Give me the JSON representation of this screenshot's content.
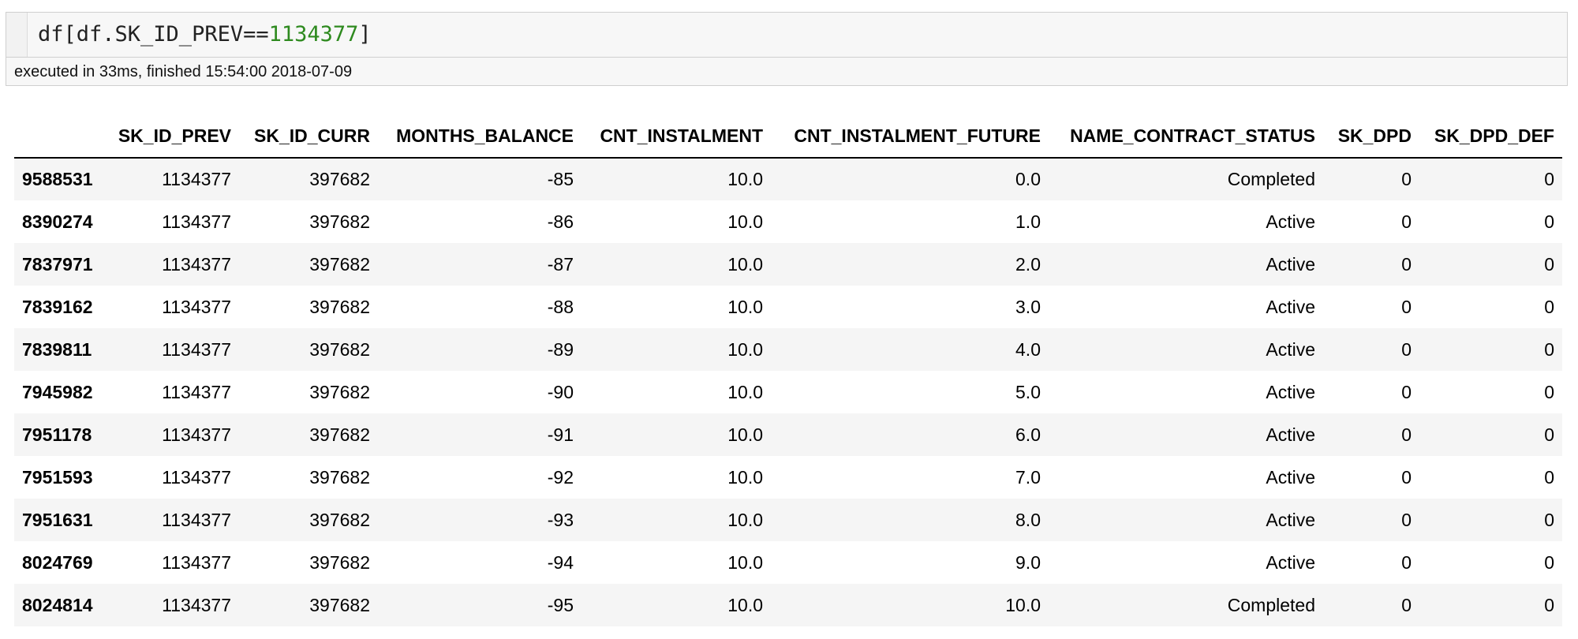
{
  "cell": {
    "code_prefix": "df[df.SK_ID_PREV==",
    "code_number": "1134377",
    "code_suffix": "]",
    "status": "executed in 33ms, finished 15:54:00 2018-07-09"
  },
  "table": {
    "columns": [
      "SK_ID_PREV",
      "SK_ID_CURR",
      "MONTHS_BALANCE",
      "CNT_INSTALMENT",
      "CNT_INSTALMENT_FUTURE",
      "NAME_CONTRACT_STATUS",
      "SK_DPD",
      "SK_DPD_DEF"
    ],
    "rows": [
      {
        "index": "9588531",
        "values": [
          "1134377",
          "397682",
          "-85",
          "10.0",
          "0.0",
          "Completed",
          "0",
          "0"
        ]
      },
      {
        "index": "8390274",
        "values": [
          "1134377",
          "397682",
          "-86",
          "10.0",
          "1.0",
          "Active",
          "0",
          "0"
        ]
      },
      {
        "index": "7837971",
        "values": [
          "1134377",
          "397682",
          "-87",
          "10.0",
          "2.0",
          "Active",
          "0",
          "0"
        ]
      },
      {
        "index": "7839162",
        "values": [
          "1134377",
          "397682",
          "-88",
          "10.0",
          "3.0",
          "Active",
          "0",
          "0"
        ]
      },
      {
        "index": "7839811",
        "values": [
          "1134377",
          "397682",
          "-89",
          "10.0",
          "4.0",
          "Active",
          "0",
          "0"
        ]
      },
      {
        "index": "7945982",
        "values": [
          "1134377",
          "397682",
          "-90",
          "10.0",
          "5.0",
          "Active",
          "0",
          "0"
        ]
      },
      {
        "index": "7951178",
        "values": [
          "1134377",
          "397682",
          "-91",
          "10.0",
          "6.0",
          "Active",
          "0",
          "0"
        ]
      },
      {
        "index": "7951593",
        "values": [
          "1134377",
          "397682",
          "-92",
          "10.0",
          "7.0",
          "Active",
          "0",
          "0"
        ]
      },
      {
        "index": "7951631",
        "values": [
          "1134377",
          "397682",
          "-93",
          "10.0",
          "8.0",
          "Active",
          "0",
          "0"
        ]
      },
      {
        "index": "8024769",
        "values": [
          "1134377",
          "397682",
          "-94",
          "10.0",
          "9.0",
          "Active",
          "0",
          "0"
        ]
      },
      {
        "index": "8024814",
        "values": [
          "1134377",
          "397682",
          "-95",
          "10.0",
          "10.0",
          "Completed",
          "0",
          "0"
        ]
      }
    ]
  }
}
